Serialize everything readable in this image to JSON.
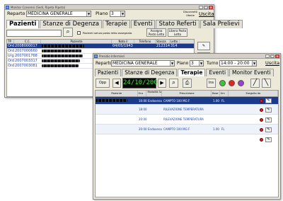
{
  "window1": {
    "title": "Monitor Consensi (Sedi, Ripeta Ripeta)",
    "reparto_label": "Reparto",
    "reparto_value": "MEDICINA GENERALE",
    "piano_label": "Piano",
    "piano_value": "3",
    "disconnetti": "Disconnetti Utente",
    "uscita": "Uscita",
    "tabs": [
      "Pazienti",
      "Stanze di Degenza",
      "Terapie",
      "Eventi",
      "Stato Referti",
      "Sala Prelievi"
    ],
    "checkbox_label": "Pazienti senza posto letto assegnato",
    "btn_assegna": "Assegna Posto Letto",
    "btn_libera": "Libera Posto Letto",
    "columns": [
      "TP",
      "C.C.",
      "Paziente",
      "Nato il",
      "Telefono",
      "Stanza",
      "Letto"
    ],
    "rows": [
      {
        "tp": "Ord",
        "cc": "2008000017",
        "nato": "04/05/1943",
        "tel": "",
        "stanza": "212314",
        "letto": "314"
      },
      {
        "tp": "Ord",
        "cc": "2007000660",
        "nato": "",
        "tel": "",
        "stanza": "",
        "letto": ""
      },
      {
        "tp": "Urg",
        "cc": "2007001768",
        "nato": "",
        "tel": "",
        "stanza": "",
        "letto": ""
      },
      {
        "tp": "Ord",
        "cc": "2007003317",
        "nato": "",
        "tel": "",
        "stanza": "",
        "letto": ""
      },
      {
        "tp": "Ord",
        "cc": "2007003081",
        "nato": "",
        "tel": "",
        "stanza": "",
        "letto": ""
      }
    ]
  },
  "window2": {
    "title": "Presidio Infermieri",
    "reparto_label": "Reparto",
    "reparto_value": "MEDICINA GENERALE",
    "piano_label": "Piano",
    "piano_value": "3",
    "turno_label": "Turno",
    "turno_value": "14:00 - 20:00",
    "uscita": "Uscita",
    "tabs": [
      "Pazienti",
      "Stanze di Degenza",
      "Terapie",
      "Eventi",
      "Monitor Eventi"
    ],
    "opp": "Opp",
    "date": "24/10/2008",
    "ins": "Ins",
    "columns": [
      "Paziente",
      "Ora",
      "Modalità Somministr.",
      "Prescrizione",
      "Dose",
      "Um",
      "Eseguito da"
    ],
    "rows": [
      {
        "ora": "10:00",
        "mod": "Endovena",
        "presc": "CAMPTO 100 MG F",
        "dose": "1.00",
        "um": "FL"
      },
      {
        "ora": "18:00",
        "mod": "",
        "presc": "RILEVAZIONE TEMPERATURA",
        "dose": "",
        "um": ""
      },
      {
        "ora": "20:00",
        "mod": "",
        "presc": "RILEVAZIONE TEMPERATURA",
        "dose": "",
        "um": ""
      },
      {
        "ora": "20:00",
        "mod": "Endovena",
        "presc": "CAMPTO 100 MG F",
        "dose": "1.00",
        "um": "FL"
      }
    ]
  }
}
